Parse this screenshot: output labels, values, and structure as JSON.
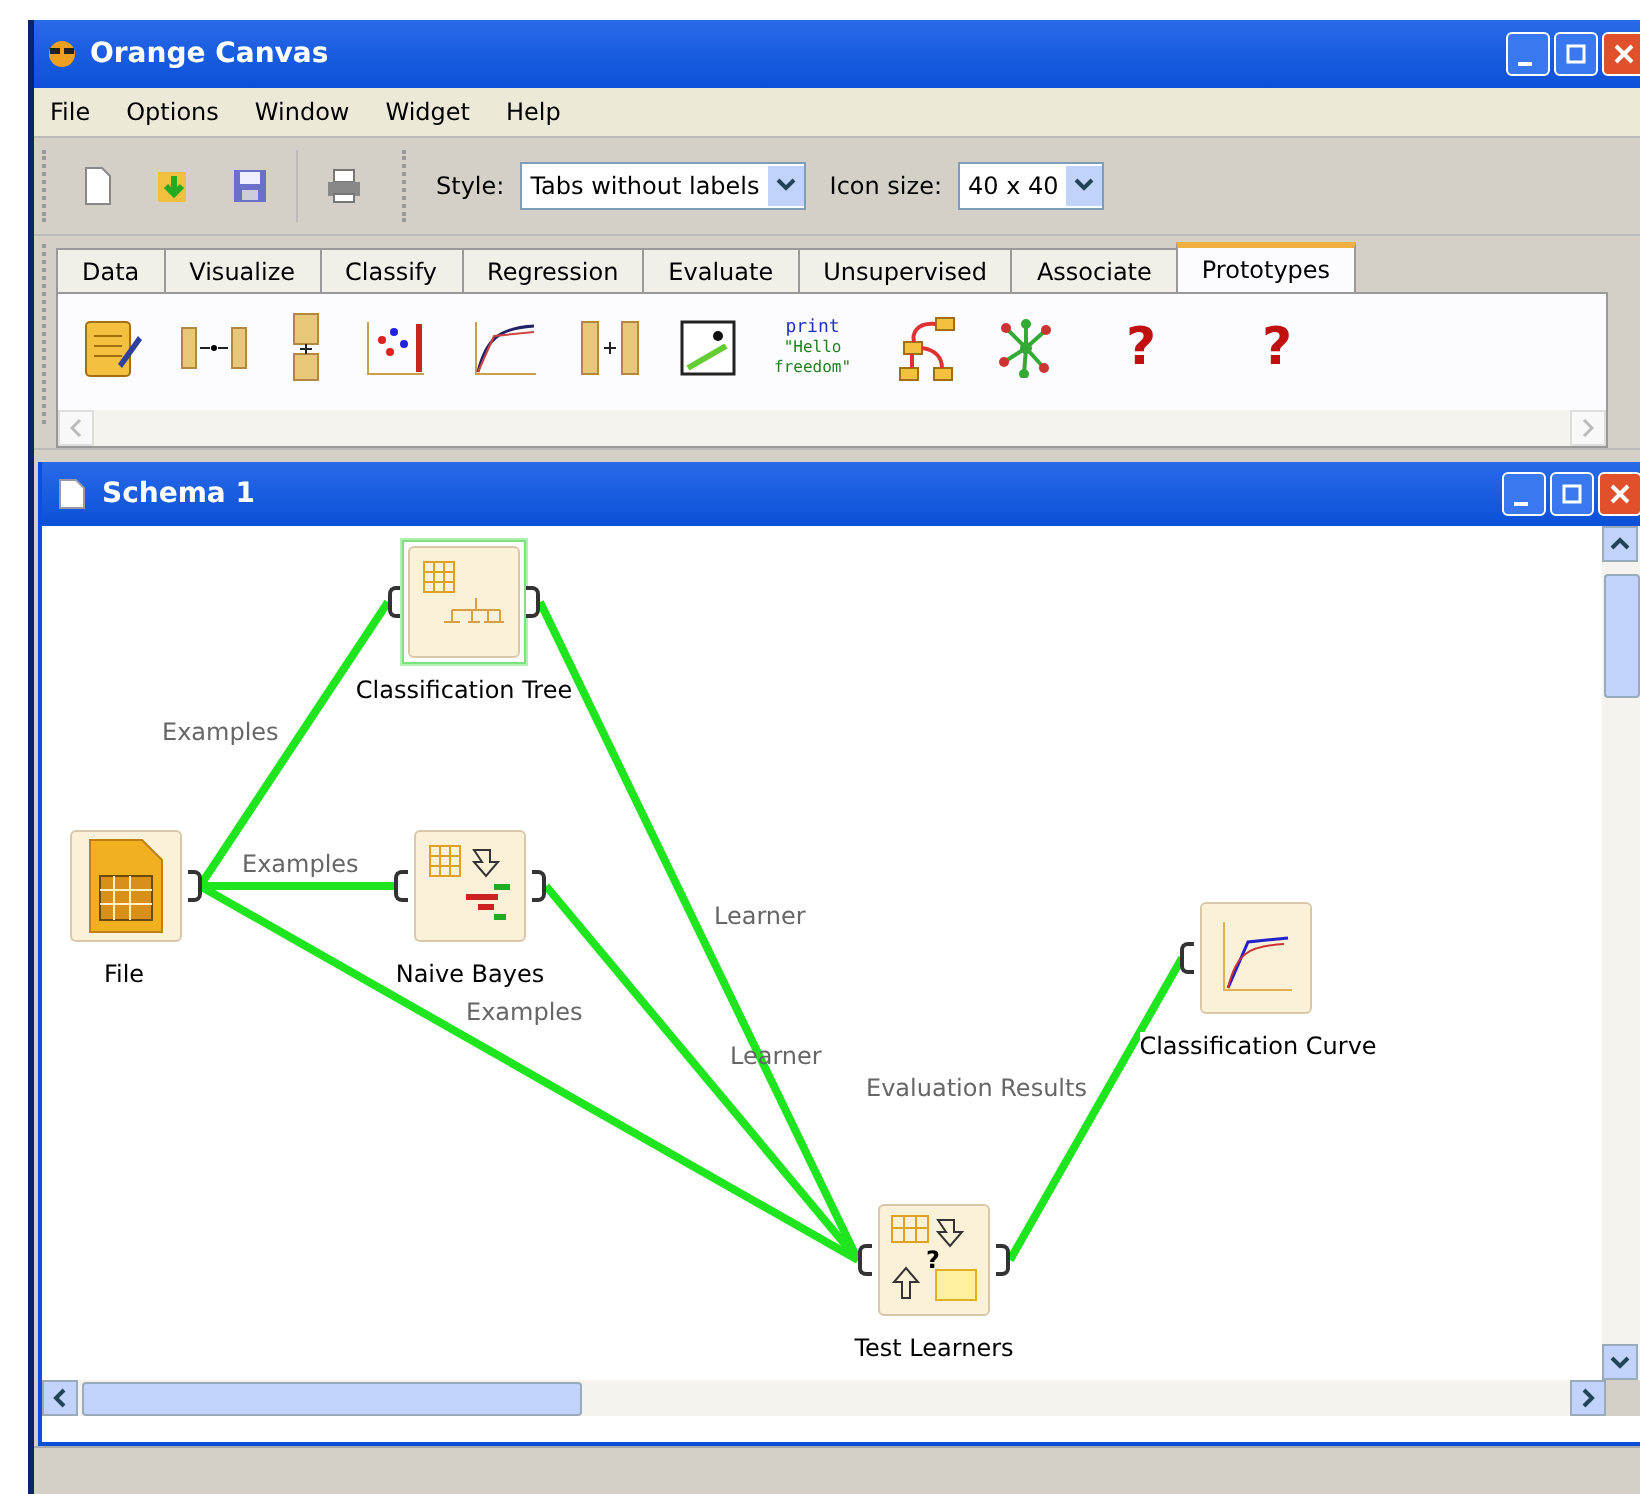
{
  "window": {
    "title": "Orange Canvas"
  },
  "menu": [
    "File",
    "Options",
    "Window",
    "Widget",
    "Help"
  ],
  "toolbar": {
    "buttons": [
      {
        "kind": "new"
      },
      {
        "kind": "open"
      },
      {
        "kind": "save"
      },
      {
        "kind": "print"
      }
    ],
    "style_label": "Style:",
    "style_value": "Tabs without labels",
    "icon_size_label": "Icon size:",
    "icon_size_value": "40 x 40"
  },
  "tabs": [
    {
      "label": "Data",
      "selected": false
    },
    {
      "label": "Visualize",
      "selected": false
    },
    {
      "label": "Classify",
      "selected": false
    },
    {
      "label": "Regression",
      "selected": false
    },
    {
      "label": "Evaluate",
      "selected": false
    },
    {
      "label": "Unsupervised",
      "selected": false
    },
    {
      "label": "Associate",
      "selected": false
    },
    {
      "label": "Prototypes",
      "selected": true
    }
  ],
  "palette": [
    {
      "kind": "notepad"
    },
    {
      "kind": "merge"
    },
    {
      "kind": "stack"
    },
    {
      "kind": "scatter"
    },
    {
      "kind": "curve"
    },
    {
      "kind": "concat"
    },
    {
      "kind": "plot"
    },
    {
      "kind": "code",
      "lines": [
        "print",
        "\"Hello",
        "freedom\""
      ]
    },
    {
      "kind": "network"
    },
    {
      "kind": "graph"
    },
    {
      "kind": "glyph",
      "text": "?"
    },
    {
      "kind": "glyph",
      "text": "?"
    }
  ],
  "schema": {
    "title": "Schema 1",
    "nodes": [
      {
        "label": "Classification Tree",
        "kind": "tree",
        "selected": true
      },
      {
        "label": "File",
        "kind": "file",
        "selected": false
      },
      {
        "label": "Naive Bayes",
        "kind": "bayes",
        "selected": false
      },
      {
        "label": "Test Learners",
        "kind": "test",
        "selected": false,
        "icon_text": "?"
      },
      {
        "label": "Classification Curve",
        "kind": "curve",
        "selected": false
      }
    ],
    "links": [
      {
        "label": "Examples"
      },
      {
        "label": "Examples"
      },
      {
        "label": "Examples"
      },
      {
        "label": "Learner"
      },
      {
        "label": "Learner"
      },
      {
        "label": "Evaluation Results"
      }
    ]
  }
}
